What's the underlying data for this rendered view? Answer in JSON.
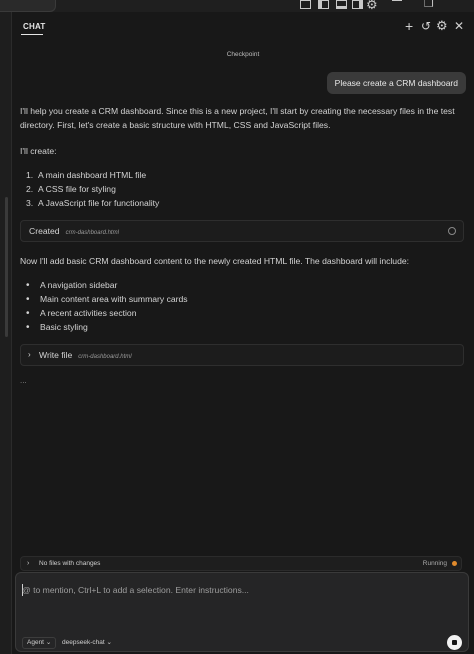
{
  "header": {
    "tab_label": "CHAT",
    "icons": [
      "plus-icon",
      "history-icon",
      "gear-icon",
      "close-icon"
    ]
  },
  "conversation": {
    "checkpoint": "Checkpoint",
    "user_message": "Please create a CRM dashboard",
    "intro": "I'll help you create a CRM dashboard. Since this is a new project, I'll start by creating the necessary files in the test directory. First, let's create a basic structure with HTML, CSS and JavaScript files.",
    "will_create": "I'll create:",
    "create_list": [
      {
        "num": "1.",
        "text": "A main dashboard HTML file"
      },
      {
        "num": "2.",
        "text": "A CSS file for styling"
      },
      {
        "num": "3.",
        "text": "A JavaScript file for functionality"
      }
    ],
    "created_card": {
      "label": "Created",
      "file": "crm-dashboard.html"
    },
    "followup": "Now I'll add basic CRM dashboard content to the newly created HTML file. The dashboard will include:",
    "include_list": [
      "A navigation sidebar",
      "Main content area with summary cards",
      "A recent activities section",
      "Basic styling"
    ],
    "write_card": {
      "label": "Write file",
      "file": "crm-dashboard.html"
    },
    "ellipsis": "..."
  },
  "status": {
    "label": "No files with changes",
    "running": "Running",
    "running_color": "#e08a2c"
  },
  "composer": {
    "placeholder": "@ to mention, Ctrl+L to add a selection. Enter instructions...",
    "agent_label": "Agent",
    "model_label": "deepseek-chat"
  }
}
